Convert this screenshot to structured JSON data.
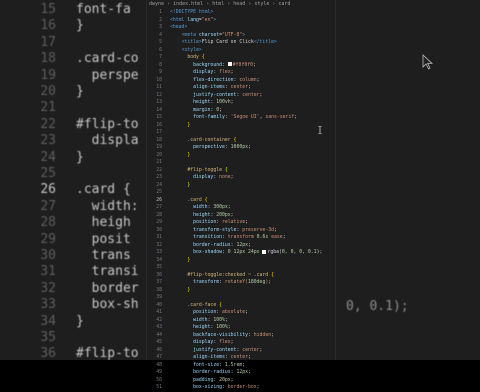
{
  "breadcrumb": [
    "dwyne",
    "index.html",
    "html",
    "head",
    "style",
    "card"
  ],
  "editor_lines": [
    {
      "n": "1",
      "html": "<span class='tag'>&lt;!DOCTYPE html&gt;</span>"
    },
    {
      "n": "2",
      "html": "<span class='tag'>&lt;html</span> <span class='attr'>lang</span>=<span class='str'>\"en\"</span><span class='tag'>&gt;</span>"
    },
    {
      "n": "3",
      "html": "<span class='tag'>&lt;head&gt;</span>"
    },
    {
      "n": "4",
      "html": "    <span class='tag'>&lt;meta</span> <span class='attr'>charset</span>=<span class='str'>\"UTF-8\"</span><span class='tag'>&gt;</span>"
    },
    {
      "n": "5",
      "html": "    <span class='tag'>&lt;title&gt;</span>Flip Card on Click<span class='tag'>&lt;/title&gt;</span>"
    },
    {
      "n": "6",
      "html": "    <span class='tag'>&lt;style&gt;</span>"
    },
    {
      "n": "7",
      "html": "      <span class='sel'>body</span> <span class='brace'>{</span>"
    },
    {
      "n": "8",
      "html": "        <span class='prop'>background</span>: <span class='swatch'></span><span class='str'>#f0f0f0</span>;"
    },
    {
      "n": "9",
      "html": "        <span class='prop'>display</span>: <span class='str'>flex</span>;"
    },
    {
      "n": "10",
      "html": "        <span class='prop'>flex-direction</span>: <span class='str'>column</span>;"
    },
    {
      "n": "11",
      "html": "        <span class='prop'>align-items</span>: <span class='str'>center</span>;"
    },
    {
      "n": "12",
      "html": "        <span class='prop'>justify-content</span>: <span class='str'>center</span>;"
    },
    {
      "n": "13",
      "html": "        <span class='prop'>height</span>: <span class='num'>100vh</span>;"
    },
    {
      "n": "14",
      "html": "        <span class='prop'>margin</span>: <span class='num'>0</span>;"
    },
    {
      "n": "15",
      "html": "        <span class='prop'>font-family</span>: <span class='str'>'Segoe UI'</span>, <span class='str'>sans-serif</span>;"
    },
    {
      "n": "16",
      "html": "      <span class='brace'>}</span>"
    },
    {
      "n": "17",
      "html": ""
    },
    {
      "n": "18",
      "html": "      <span class='sel'>.card-container</span> <span class='brace'>{</span>"
    },
    {
      "n": "19",
      "html": "        <span class='prop'>perspective</span>: <span class='num'>1000px</span>;"
    },
    {
      "n": "20",
      "html": "      <span class='brace'>}</span>"
    },
    {
      "n": "21",
      "html": ""
    },
    {
      "n": "22",
      "html": "      <span class='sel'>#flip-toggle</span> <span class='brace'>{</span>"
    },
    {
      "n": "23",
      "html": "        <span class='prop'>display</span>: <span class='str'>none</span>;"
    },
    {
      "n": "24",
      "html": "      <span class='brace'>}</span>"
    },
    {
      "n": "25",
      "html": ""
    },
    {
      "n": "26",
      "html": "      <span class='sel'>.card</span> <span class='brace'>{</span>",
      "active": true
    },
    {
      "n": "27",
      "html": "        <span class='prop'>width</span>: <span class='num'>300px</span>;"
    },
    {
      "n": "28",
      "html": "        <span class='prop'>height</span>: <span class='num'>200px</span>;"
    },
    {
      "n": "29",
      "html": "        <span class='prop'>position</span>: <span class='str'>relative</span>;"
    },
    {
      "n": "30",
      "html": "        <span class='prop'>transform-style</span>: <span class='str'>preserve-3d</span>;"
    },
    {
      "n": "31",
      "html": "        <span class='prop'>transition</span>: <span class='str'>transform</span> <span class='num'>0.6s</span> <span class='str'>ease</span>;"
    },
    {
      "n": "32",
      "html": "        <span class='prop'>border-radius</span>: <span class='num'>12px</span>;"
    },
    {
      "n": "33",
      "html": "        <span class='prop'>box-shadow</span>: <span class='num'>0 12px 24px</span> <span class='swatch'></span>rgba(<span class='num'>0, 0, 0, 0.1</span>);"
    },
    {
      "n": "34",
      "html": "      <span class='brace'>}</span>"
    },
    {
      "n": "35",
      "html": ""
    },
    {
      "n": "36",
      "html": "      <span class='sel'>#flip-toggle:checked ~ .card</span> <span class='brace'>{</span>"
    },
    {
      "n": "37",
      "html": "        <span class='prop'>transform</span>: <span class='str'>rotateY(</span><span class='num'>180deg</span><span class='str'>)</span>;"
    },
    {
      "n": "38",
      "html": "      <span class='brace'>}</span>"
    },
    {
      "n": "39",
      "html": ""
    },
    {
      "n": "40",
      "html": "      <span class='sel'>.card-face</span> <span class='brace'>{</span>"
    },
    {
      "n": "41",
      "html": "        <span class='prop'>position</span>: <span class='str'>absolute</span>;"
    },
    {
      "n": "42",
      "html": "        <span class='prop'>width</span>: <span class='num'>100%</span>;"
    },
    {
      "n": "43",
      "html": "        <span class='prop'>height</span>: <span class='num'>100%</span>;"
    },
    {
      "n": "44",
      "html": "        <span class='prop'>backface-visibility</span>: <span class='str'>hidden</span>;"
    },
    {
      "n": "45",
      "html": "        <span class='prop'>display</span>: <span class='str'>flex</span>;"
    },
    {
      "n": "46",
      "html": "        <span class='prop'>justify-content</span>: <span class='str'>center</span>;"
    },
    {
      "n": "47",
      "html": "        <span class='prop'>align-items</span>: <span class='str'>center</span>;"
    },
    {
      "n": "48",
      "html": "        <span class='prop'>font-size</span>: <span class='num'>1.5rem</span>;"
    },
    {
      "n": "49",
      "html": "        <span class='prop'>border-radius</span>: <span class='num'>12px</span>;"
    },
    {
      "n": "50",
      "html": "        <span class='prop'>padding</span>: <span class='num'>20px</span>;"
    },
    {
      "n": "51",
      "html": "        <span class='prop'>box-sizing</span>: <span class='str'>border-box</span>;"
    }
  ],
  "bg_left": [
    {
      "n": "15",
      "code": "font-fa"
    },
    {
      "n": "16",
      "code": "}"
    },
    {
      "n": "17",
      "code": ""
    },
    {
      "n": "18",
      "code": ".card-co"
    },
    {
      "n": "19",
      "code": "  perspe"
    },
    {
      "n": "20",
      "code": "}"
    },
    {
      "n": "21",
      "code": ""
    },
    {
      "n": "22",
      "code": "#flip-to"
    },
    {
      "n": "23",
      "code": "  displa"
    },
    {
      "n": "24",
      "code": "}"
    },
    {
      "n": "25",
      "code": ""
    },
    {
      "n": "26",
      "code": ".card {",
      "active": true
    },
    {
      "n": "27",
      "code": "  width:"
    },
    {
      "n": "28",
      "code": "  heigh"
    },
    {
      "n": "29",
      "code": "  posit"
    },
    {
      "n": "30",
      "code": "  trans"
    },
    {
      "n": "31",
      "code": "  transi"
    },
    {
      "n": "32",
      "code": "  border"
    },
    {
      "n": "33",
      "code": "  box-sh"
    },
    {
      "n": "34",
      "code": "}"
    },
    {
      "n": "35",
      "code": ""
    },
    {
      "n": "36",
      "code": "#flip-to"
    }
  ],
  "bg_right_text": "0, 0.1);"
}
